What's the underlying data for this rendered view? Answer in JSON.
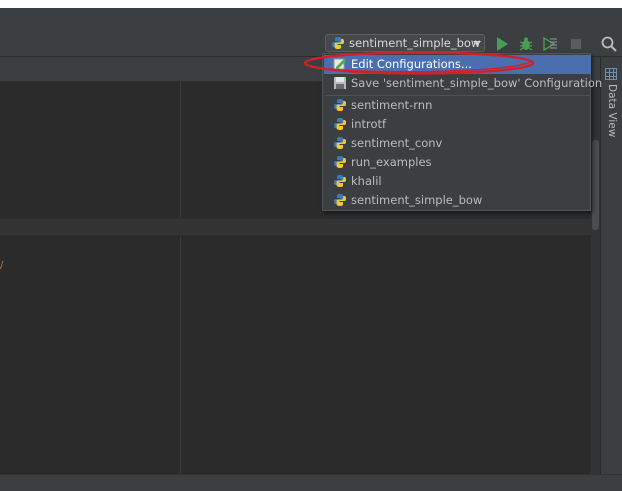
{
  "run_config": {
    "selected": "sentiment_simple_bow"
  },
  "menu": {
    "actions": [
      {
        "label": "Edit Configurations...",
        "icon": "edit-configurations-icon"
      },
      {
        "label": "Save 'sentiment_simple_bow' Configuration",
        "icon": "save-icon"
      }
    ],
    "configs": [
      {
        "label": "sentiment-rnn",
        "icon": "python-icon"
      },
      {
        "label": "introtf",
        "icon": "python-icon"
      },
      {
        "label": "sentiment_conv",
        "icon": "python-icon"
      },
      {
        "label": "run_examples",
        "icon": "python-icon"
      },
      {
        "label": "khalil",
        "icon": "python-icon"
      },
      {
        "label": "sentiment_simple_bow",
        "icon": "python-icon"
      }
    ]
  },
  "sidebar": {
    "data_view_label": "Data View"
  },
  "colors": {
    "accent_selection": "#4b6eaf",
    "highlight_annotation": "#d0202a",
    "run_green": "#499c54"
  }
}
